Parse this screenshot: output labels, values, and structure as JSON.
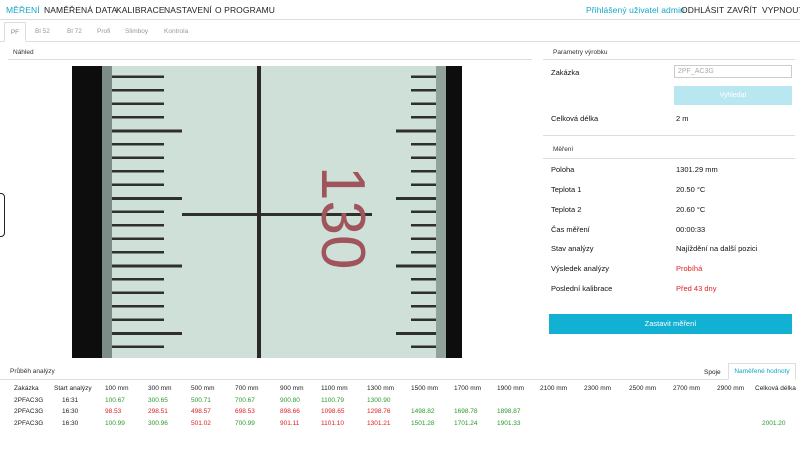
{
  "nav": {
    "items": [
      "MĚŘENÍ",
      "NAMĚŘENÁ DATA",
      "KALIBRACE",
      "NASTAVENÍ",
      "O PROGRAMU"
    ],
    "user": "Přihlášený uživatel admin",
    "logout": "ODHLÁSIT",
    "close": "ZAVŘÍT",
    "shutdown": "VYPNOUT"
  },
  "subtabs": [
    "PF",
    "Bl 52",
    "Bl 72",
    "Profi",
    "Slimboy",
    "Kontrola"
  ],
  "preview": {
    "title": "Náhled",
    "scale_number": "130"
  },
  "product": {
    "title": "Parametry výrobku",
    "order_label": "Zakázka",
    "order_value": "2PF_AC3G",
    "select_button": "Vyhledat",
    "length_label": "Celková délka",
    "length_value": "2 m"
  },
  "measurement": {
    "title": "Měření",
    "rows": [
      {
        "label": "Poloha",
        "value": "1301.29 mm"
      },
      {
        "label": "Teplota 1",
        "value": "20.50 °C"
      },
      {
        "label": "Teplota 2",
        "value": "20.60 °C"
      },
      {
        "label": "Čas měření",
        "value": "00:00:33"
      },
      {
        "label": "Stav analýzy",
        "value": "Najíždění na další pozici"
      },
      {
        "label": "Výsledek analýzy",
        "value": "Probíhá"
      },
      {
        "label": "Poslední kalibrace",
        "value": "Před 43 dny"
      }
    ],
    "stop_button": "Zastavit měření"
  },
  "analysis": {
    "title": "Průběh analýzy",
    "tab_sync": "Spoje",
    "tab_values": "Naměřené hodnoty",
    "columns": [
      "Zakázka",
      "Start analýzy",
      "100 mm",
      "300 mm",
      "500 mm",
      "700 mm",
      "900 mm",
      "1100 mm",
      "1300 mm",
      "1500 mm",
      "1700 mm",
      "1900 mm",
      "2100 mm",
      "2300 mm",
      "2500 mm",
      "2700 mm",
      "2900 mm",
      "Celková délka"
    ],
    "rows": [
      {
        "order": "2PFAC3G",
        "start": "16:31",
        "values": [
          "100.67",
          "300.65",
          "500.71",
          "700.67",
          "900.80",
          "1100.79",
          "1300.90",
          "",
          "",
          "",
          "",
          "",
          "",
          "",
          "",
          ""
        ],
        "colors": [
          "green",
          "green",
          "green",
          "green",
          "green",
          "green",
          "green",
          "",
          "",
          "",
          "",
          "",
          "",
          "",
          "",
          ""
        ]
      },
      {
        "order": "2PFAC3G",
        "start": "16:30",
        "values": [
          "98.53",
          "298.51",
          "498.57",
          "698.53",
          "898.66",
          "1098.65",
          "1298.76",
          "1498.82",
          "1698.78",
          "1898.87",
          "",
          "",
          "",
          "",
          "",
          ""
        ],
        "colors": [
          "red",
          "red",
          "red",
          "red",
          "red",
          "red",
          "red",
          "green",
          "green",
          "green",
          "",
          "",
          "",
          "",
          "",
          ""
        ]
      },
      {
        "order": "2PFAC3G",
        "start": "16:30",
        "values": [
          "100.99",
          "300.96",
          "501.02",
          "700.99",
          "901.11",
          "1101.10",
          "1301.21",
          "1501.28",
          "1701.24",
          "1901.33",
          "",
          "",
          "",
          "",
          "",
          "2001.20"
        ],
        "colors": [
          "green",
          "green",
          "red",
          "green",
          "red",
          "red",
          "red",
          "green",
          "green",
          "green",
          "",
          "",
          "",
          "",
          "",
          "green"
        ]
      }
    ]
  },
  "colors": {
    "accent": "#12a7c8",
    "button": "#12b0d2",
    "ok": "#2a9a2a",
    "error": "#e02020",
    "scale_bg": "#c8ddd6",
    "scale_marks": "#2a2a2a",
    "scale_digits": "#a0545c"
  }
}
